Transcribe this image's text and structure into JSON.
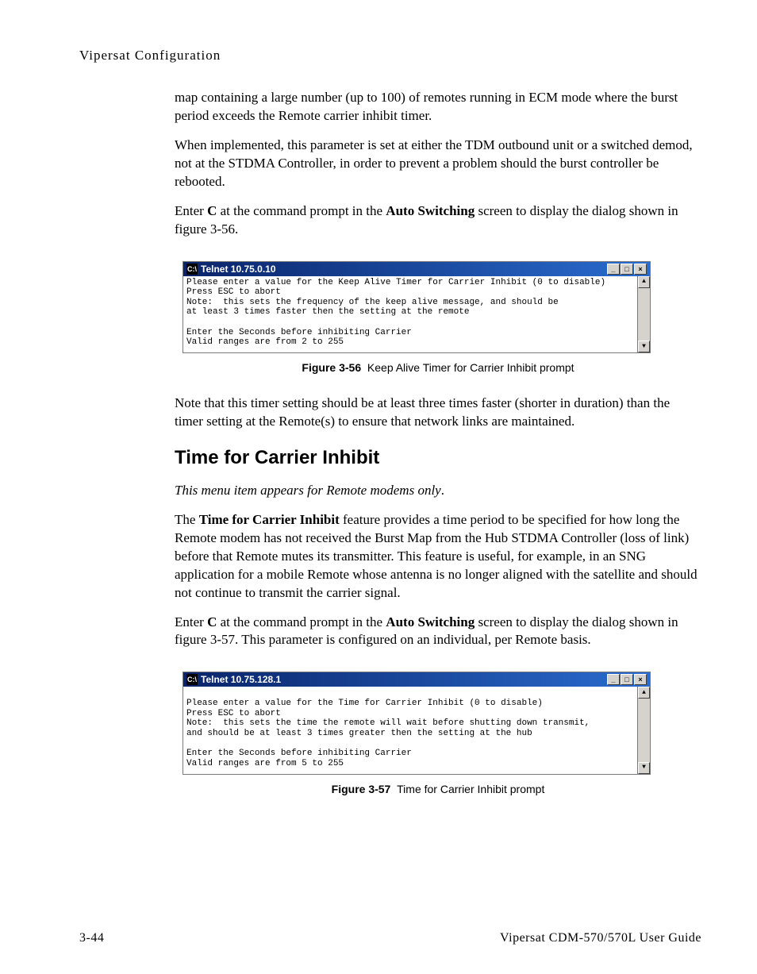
{
  "header": {
    "section_title": "Vipersat Configuration"
  },
  "paragraphs": {
    "p1": "map containing a large number (up to 100) of remotes running in ECM mode where the burst period exceeds the Remote carrier inhibit timer.",
    "p2": "When implemented, this parameter is set at either the TDM outbound unit or a switched demod, not at the STDMA Controller, in order to prevent a problem should the burst controller be rebooted.",
    "p3a": "Enter ",
    "p3b": "C",
    "p3c": " at the command prompt in the ",
    "p3d": "Auto Switching",
    "p3e": " screen to display the dialog shown in figure 3-56.",
    "p4": "Note that this timer setting should be at least three times faster (shorter in duration) than the timer setting at the Remote(s) to ensure that network links are maintained.",
    "p5": "This menu item appears for Remote modems only",
    "p5_period": ".",
    "p6a": "The ",
    "p6b": "Time for Carrier Inhibit",
    "p6c": " feature provides a time period to be specified for how long the Remote modem has not received the Burst Map from the Hub STDMA Controller (loss of link) before that Remote mutes its transmitter. This feature is useful, for example, in an SNG application for a mobile Remote whose antenna is no longer aligned with the satellite and should not continue to transmit the carrier signal.",
    "p7a": "Enter ",
    "p7b": "C",
    "p7c": " at the command prompt in the ",
    "p7d": "Auto Switching",
    "p7e": " screen to display the dialog shown in figure 3-57. This parameter is configured on an individual, per Remote basis."
  },
  "heading": {
    "h1": "Time for Carrier Inhibit"
  },
  "telnet1": {
    "title": "Telnet 10.75.0.10",
    "body": "Please enter a value for the Keep Alive Timer for Carrier Inhibit (0 to disable)\nPress ESC to abort\nNote:  this sets the frequency of the keep alive message, and should be\nat least 3 times faster then the setting at the remote\n\nEnter the Seconds before inhibiting Carrier\nValid ranges are from 2 to 255"
  },
  "telnet2": {
    "title": "Telnet 10.75.128.1",
    "body": "\nPlease enter a value for the Time for Carrier Inhibit (0 to disable)\nPress ESC to abort\nNote:  this sets the time the remote will wait before shutting down transmit,\nand should be at least 3 times greater then the setting at the hub\n\nEnter the Seconds before inhibiting Carrier\nValid ranges are from 5 to 255"
  },
  "figures": {
    "fig1_label": "Figure 3-56",
    "fig1_caption": "Keep Alive Timer for Carrier Inhibit prompt",
    "fig2_label": "Figure 3-57",
    "fig2_caption": "Time for Carrier Inhibit prompt"
  },
  "window_controls": {
    "min": "_",
    "max": "□",
    "close": "×",
    "up": "▲",
    "down": "▼",
    "icon_text": "C:\\"
  },
  "footer": {
    "page": "3-44",
    "doc_title": "Vipersat CDM-570/570L User Guide"
  }
}
